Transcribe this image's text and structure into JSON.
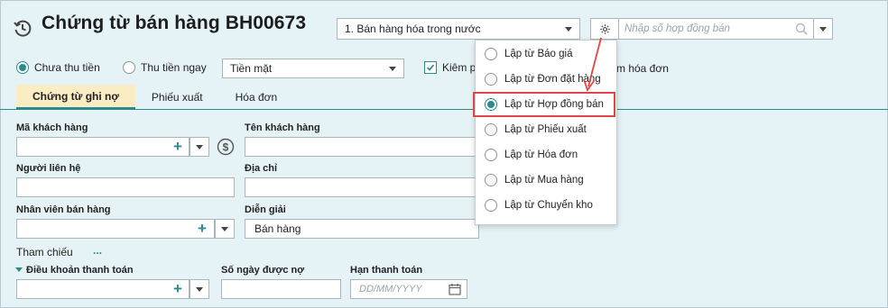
{
  "header": {
    "title": "Chứng từ bán hàng BH00673",
    "sale_type": "1. Bán hàng hóa trong nước",
    "contract_search_placeholder": "Nhập số hợp đồng bán"
  },
  "payment": {
    "option_unpaid": "Chưa thu tiền",
    "option_paid": "Thu tiền ngay",
    "selected": "Chưa thu tiền",
    "method": "Tiền mặt",
    "checkbox_label_left": "Kiêm p",
    "checkbox_label_right": "m hóa đơn",
    "checkbox_checked": true
  },
  "tabs": [
    {
      "label": "Chứng từ ghi nợ",
      "active": true
    },
    {
      "label": "Phiếu xuất",
      "active": false
    },
    {
      "label": "Hóa đơn",
      "active": false
    }
  ],
  "form": {
    "customer_code_label": "Mã khách hàng",
    "customer_name_label": "Tên khách hàng",
    "contact_label": "Người liên hệ",
    "address_label": "Địa chỉ",
    "salesperson_label": "Nhân viên bán hàng",
    "description_label": "Diễn giải",
    "description_value": "Bán hàng",
    "reference_label": "Tham chiếu",
    "reference_more": "...",
    "payment_terms_label": "Điều khoản thanh toán",
    "debt_days_label": "Số ngày được nợ",
    "due_date_label": "Hạn thanh toán",
    "due_date_placeholder": "DD/MM/YYYY"
  },
  "popup": {
    "items": [
      {
        "label": "Lập từ Báo giá",
        "selected": false
      },
      {
        "label": "Lập từ Đơn đặt hàng",
        "selected": false
      },
      {
        "label": "Lập từ Hợp đồng bán",
        "selected": true
      },
      {
        "label": "Lập từ Phiếu xuất",
        "selected": false
      },
      {
        "label": "Lập từ Hóa đơn",
        "selected": false
      },
      {
        "label": "Lập từ Mua hàng",
        "selected": false
      },
      {
        "label": "Lập từ Chuyển kho",
        "selected": false
      }
    ]
  },
  "colors": {
    "accent": "#2a8a8f",
    "background": "#e6f3f6",
    "active_tab": "#fbedc3",
    "highlight": "#e04646"
  }
}
